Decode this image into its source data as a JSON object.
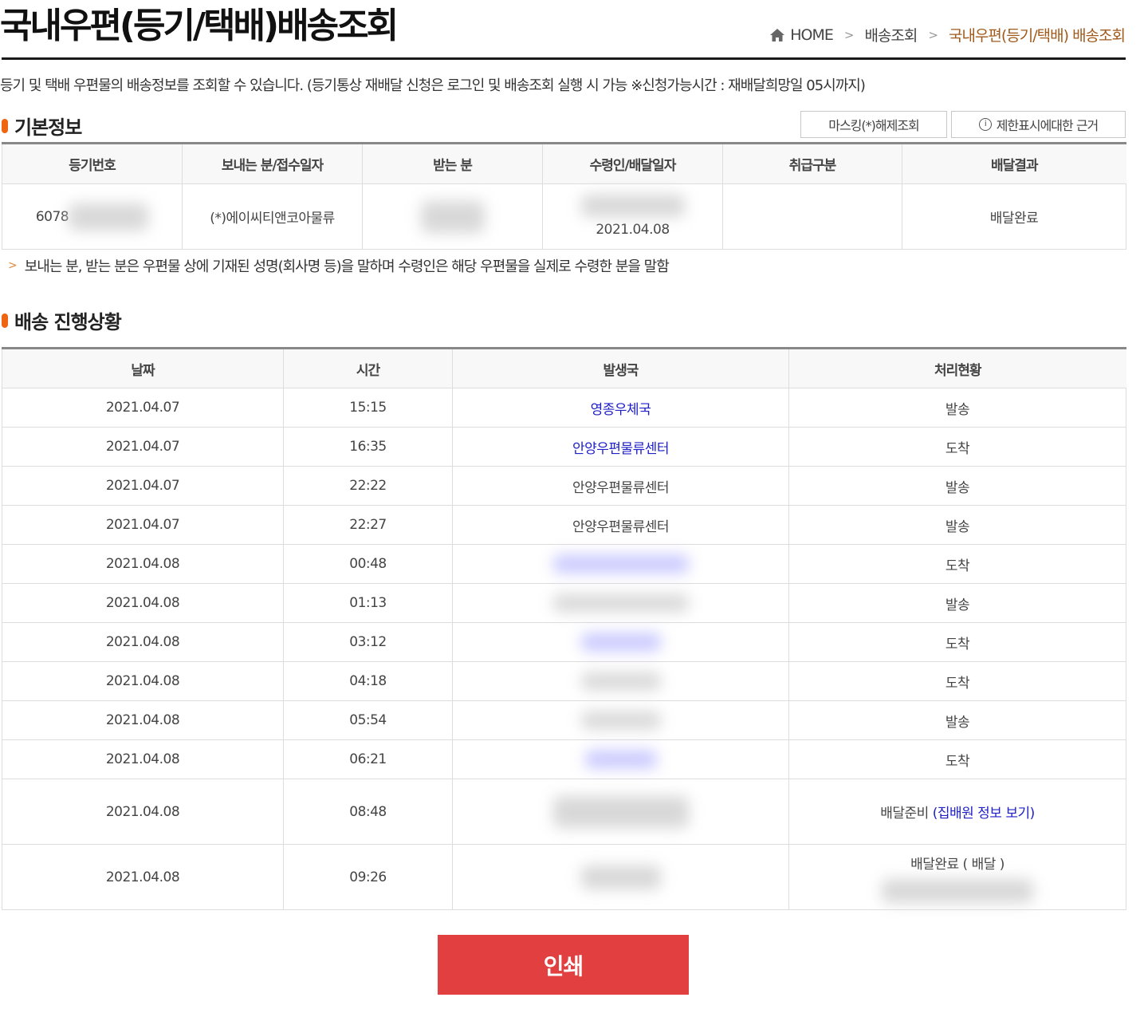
{
  "header": {
    "title": "국내우편(등기/택배)배송조회",
    "breadcrumb": {
      "home": "HOME",
      "level1": "배송조회",
      "current": "국내우편(등기/택배) 배송조회"
    }
  },
  "intro_text": "등기 및 택배 우편물의 배송정보를 조회할 수 있습니다. (등기통상 재배달 신청은 로그인 및 배송조회 실행 시 가능 ※신청가능시간 : 재배달희망일 05시까지)",
  "basic_info": {
    "section_title": "기본정보",
    "unmask_button": "마스킹(*)해제조회",
    "restriction_button": "제한표시에대한 근거",
    "restriction_icon": "i-circle-icon",
    "columns": [
      "등기번호",
      "보내는 분/접수일자",
      "받는 분",
      "수령인/배달일자",
      "취급구분",
      "배달결과"
    ],
    "row": {
      "tracking_no": "6078",
      "sender": "(*)에이씨티앤코아물류",
      "receiver": "",
      "delivery_date": "2021.04.08",
      "handling": "",
      "result": "배달완료"
    },
    "note": "보내는 분, 받는 분은 우편물 상에 기재된 성명(회사명 등)을 말하며 수령인은 해당 우편물을 실제로 수령한 분을 말함"
  },
  "progress": {
    "section_title": "배송 진행상황",
    "columns": [
      "날짜",
      "시간",
      "발생국",
      "처리현황"
    ],
    "rows": [
      {
        "date": "2021.04.07",
        "time": "15:15",
        "office": "영종우체국",
        "status": "발송"
      },
      {
        "date": "2021.04.07",
        "time": "16:35",
        "office": "안양우편물류센터",
        "status": "도착"
      },
      {
        "date": "2021.04.07",
        "time": "22:22",
        "office": "안양우편물류센터",
        "status": "발송"
      },
      {
        "date": "2021.04.07",
        "time": "22:27",
        "office": "안양우편물류센터",
        "status": "발송"
      },
      {
        "date": "2021.04.08",
        "time": "00:48",
        "office": "",
        "status": "도착"
      },
      {
        "date": "2021.04.08",
        "time": "01:13",
        "office": "",
        "status": "발송"
      },
      {
        "date": "2021.04.08",
        "time": "03:12",
        "office": "",
        "status": "도착"
      },
      {
        "date": "2021.04.08",
        "time": "04:18",
        "office": "",
        "status": "도착"
      },
      {
        "date": "2021.04.08",
        "time": "05:54",
        "office": "",
        "status": "발송"
      },
      {
        "date": "2021.04.08",
        "time": "06:21",
        "office": "",
        "status": "도착"
      },
      {
        "date": "2021.04.08",
        "time": "08:48",
        "office": "",
        "status": "배달준비",
        "status_link": "(집배원 정보 보기)"
      },
      {
        "date": "2021.04.08",
        "time": "09:26",
        "office": "",
        "status": "배달완료 ( 배달 )"
      }
    ]
  },
  "print_button": "인쇄",
  "colors": {
    "accent_orange": "#ee6611",
    "breadcrumb_current": "#a05a1c",
    "link_blue": "#2020c8",
    "print_red": "#e24040"
  }
}
